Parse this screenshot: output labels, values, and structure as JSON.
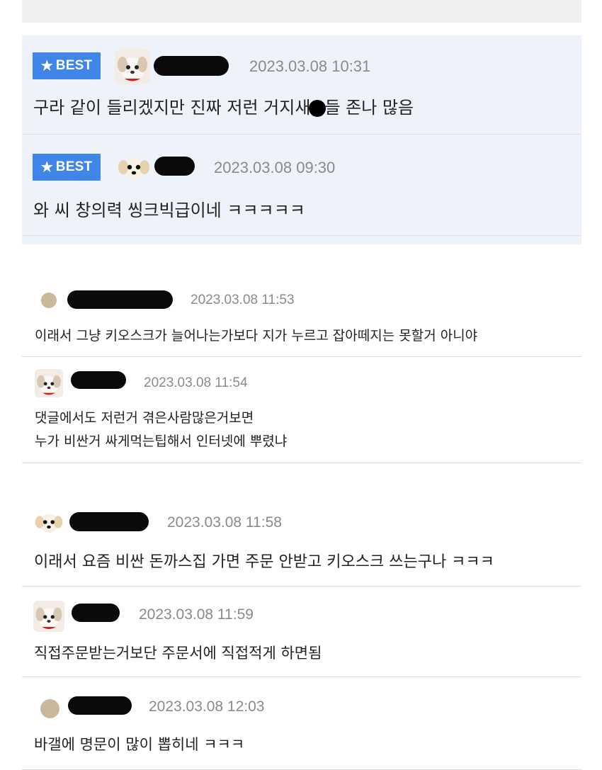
{
  "best_comments": [
    {
      "badge_label": "BEST",
      "badge_icon": "star-icon",
      "avatar": "puppy-avatar",
      "timestamp": "2023.03.08 10:31",
      "text_before": "구라 같이 들리겠지만 진짜 저런 거지새",
      "text_after": "들 존나 많음"
    },
    {
      "badge_label": "BEST",
      "badge_icon": "star-icon",
      "avatar": "puppy-face-avatar",
      "timestamp": "2023.03.08 09:30",
      "text": "와 씨 창의력 씽크빅급이네 ㅋㅋㅋㅋㅋ"
    }
  ],
  "comments": [
    {
      "avatar": "dot-avatar",
      "timestamp": "2023.03.08 11:53",
      "lines": [
        "이래서 그냥 키오스크가 늘어나는가보다 지가 누르고 잡아떼지는 못할거 아니야"
      ]
    },
    {
      "avatar": "puppy-avatar",
      "timestamp": "2023.03.08 11:54",
      "lines": [
        "댓글에서도 저런거 겪은사람많은거보면",
        "누가 비싼거 싸게먹는팁해서 인터넷에 뿌렸냐"
      ]
    },
    {
      "avatar": "puppy-face-avatar",
      "timestamp": "2023.03.08 11:58",
      "lines": [
        "이래서 요즘 비싼 돈까스집 가면 주문 안받고 키오스크 쓰는구나 ㅋㅋㅋ"
      ]
    },
    {
      "avatar": "puppy-avatar",
      "timestamp": "2023.03.08 11:59",
      "lines": [
        "직접주문받는거보단 주문서에 직접적게 하면됨"
      ]
    },
    {
      "avatar": "dot-avatar",
      "timestamp": "2023.03.08 12:03",
      "lines": [
        "바갤에 명문이 많이 뽑히네 ㅋㅋㅋ"
      ]
    }
  ],
  "colors": {
    "best_bg": "#eef3fb",
    "badge": "#3f86e8",
    "timestamp": "#8a8a8a",
    "divider": "#dcdcdc"
  }
}
